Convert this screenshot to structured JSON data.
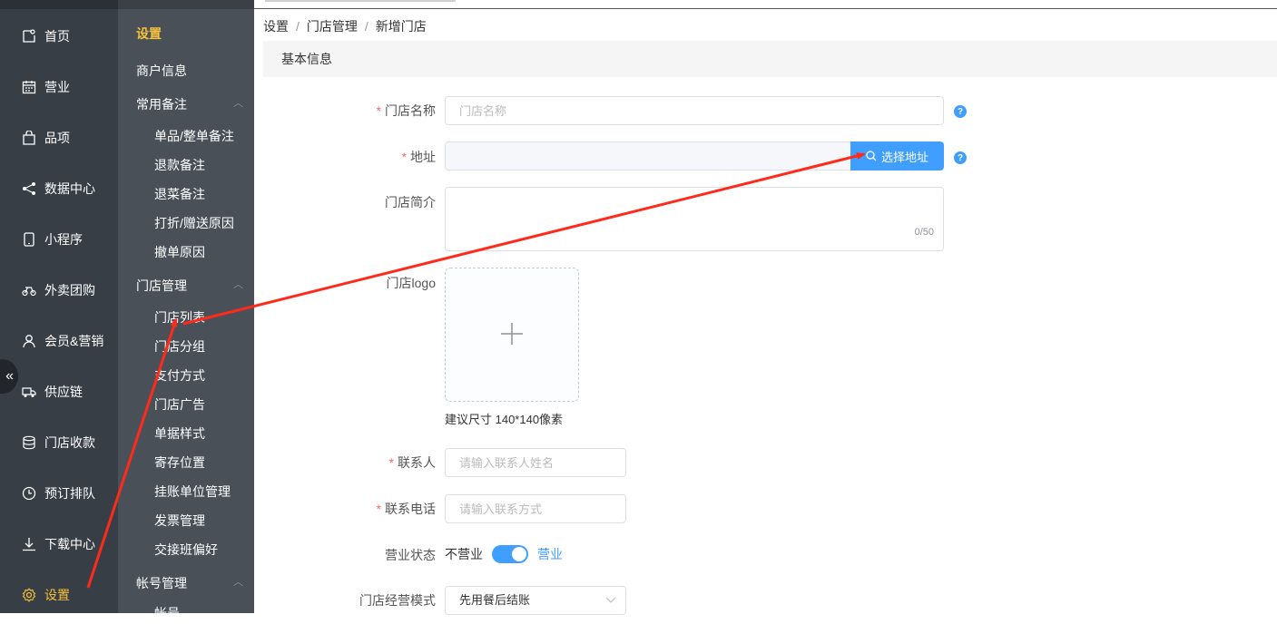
{
  "left_nav": {
    "items": [
      {
        "label": "首页",
        "icon": "home-icon"
      },
      {
        "label": "营业",
        "icon": "calendar-icon"
      },
      {
        "label": "品项",
        "icon": "bag-icon"
      },
      {
        "label": "数据中心",
        "icon": "share-icon"
      },
      {
        "label": "小程序",
        "icon": "phone-icon"
      },
      {
        "label": "外卖团购",
        "icon": "bike-icon"
      },
      {
        "label": "会员&营销",
        "icon": "user-icon"
      },
      {
        "label": "供应链",
        "icon": "truck-icon"
      },
      {
        "label": "门店收款",
        "icon": "database-icon"
      },
      {
        "label": "预订排队",
        "icon": "clock-icon"
      },
      {
        "label": "下载中心",
        "icon": "download-icon"
      },
      {
        "label": "设置",
        "icon": "gear-icon"
      }
    ],
    "active": "设置",
    "collapse_symbol": "«"
  },
  "sub_nav": {
    "title": "设置",
    "merchant_info": "商户信息",
    "group_remarks": {
      "label": "常用备注",
      "chevron": "︿"
    },
    "remarks_children": [
      "单品/整单备注",
      "退款备注",
      "退菜备注",
      "打折/赠送原因",
      "撤单原因"
    ],
    "group_store": {
      "label": "门店管理",
      "chevron": "︿"
    },
    "store_children": [
      "门店列表",
      "门店分组",
      "支付方式",
      "门店广告",
      "单据样式",
      "寄存位置",
      "挂账单位管理",
      "发票管理",
      "交接班偏好"
    ],
    "group_account": {
      "label": "帐号管理",
      "chevron": "︿"
    },
    "account_children": [
      "帐号"
    ]
  },
  "breadcrumb": {
    "items": [
      "设置",
      "门店管理",
      "新增门店"
    ],
    "separator": "/"
  },
  "section": {
    "title": "基本信息"
  },
  "form": {
    "required_mark": "*",
    "store_name": {
      "label": "门店名称",
      "placeholder": "门店名称"
    },
    "address": {
      "label": "地址",
      "button": "选择地址"
    },
    "intro": {
      "label": "门店简介",
      "counter": "0/50"
    },
    "logo": {
      "label": "门店logo",
      "hint": "建议尺寸 140*140像素"
    },
    "contact": {
      "label": "联系人",
      "placeholder": "请输入联系人姓名"
    },
    "phone": {
      "label": "联系电话",
      "placeholder": "请输入联系方式"
    },
    "status": {
      "label": "营业状态",
      "off_text": "不营业",
      "on_text": "营业",
      "value": true
    },
    "mode": {
      "label": "门店经营模式",
      "value": "先用餐后结账"
    },
    "help_symbol": "?"
  },
  "colors": {
    "accent": "#409eff",
    "active_nav": "#f5c13b",
    "annotation_arrow": "#ff2a1a"
  }
}
